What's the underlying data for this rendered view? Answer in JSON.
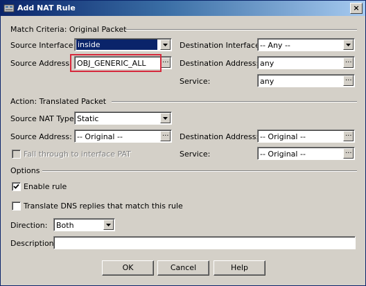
{
  "window": {
    "title": "Add NAT Rule",
    "close_glyph": "×"
  },
  "match": {
    "heading": "Match Criteria: Original Packet",
    "source_interface": {
      "label": "Source Interface:",
      "value": "inside"
    },
    "destination_interface": {
      "label": "Destination Interface:",
      "value": "-- Any --"
    },
    "source_address": {
      "label": "Source Address:",
      "value": "OBJ_GENERIC_ALL"
    },
    "destination_address": {
      "label": "Destination Address:",
      "value": "any"
    },
    "service": {
      "label": "Service:",
      "value": "any"
    }
  },
  "action": {
    "heading": "Action: Translated Packet",
    "source_nat_type": {
      "label": "Source NAT Type:",
      "value": "Static"
    },
    "source_address": {
      "label": "Source Address:",
      "value": "-- Original --"
    },
    "destination_address": {
      "label": "Destination Address:",
      "value": "-- Original --"
    },
    "fall_through": {
      "label": "Fall through to interface PAT",
      "checked": false,
      "disabled": true
    },
    "service": {
      "label": "Service:",
      "value": "-- Original --"
    }
  },
  "options": {
    "heading": "Options",
    "enable_rule": {
      "label": "Enable rule",
      "checked": true
    },
    "translate_dns": {
      "label": "Translate DNS replies that match this rule",
      "checked": false
    },
    "direction": {
      "label": "Direction:",
      "value": "Both"
    },
    "description": {
      "label": "Description:",
      "value": ""
    }
  },
  "buttons": {
    "ok": "OK",
    "cancel": "Cancel",
    "help": "Help"
  },
  "colors": {
    "highlight": "#d6283c",
    "title_bar": "#0a246a",
    "dialog_bg": "#d4d0c8"
  },
  "icons": {
    "title": "nat-rule-icon",
    "dropdown": "chevron-down-icon",
    "browse": "ellipsis-icon",
    "check": "checkmark-icon"
  }
}
